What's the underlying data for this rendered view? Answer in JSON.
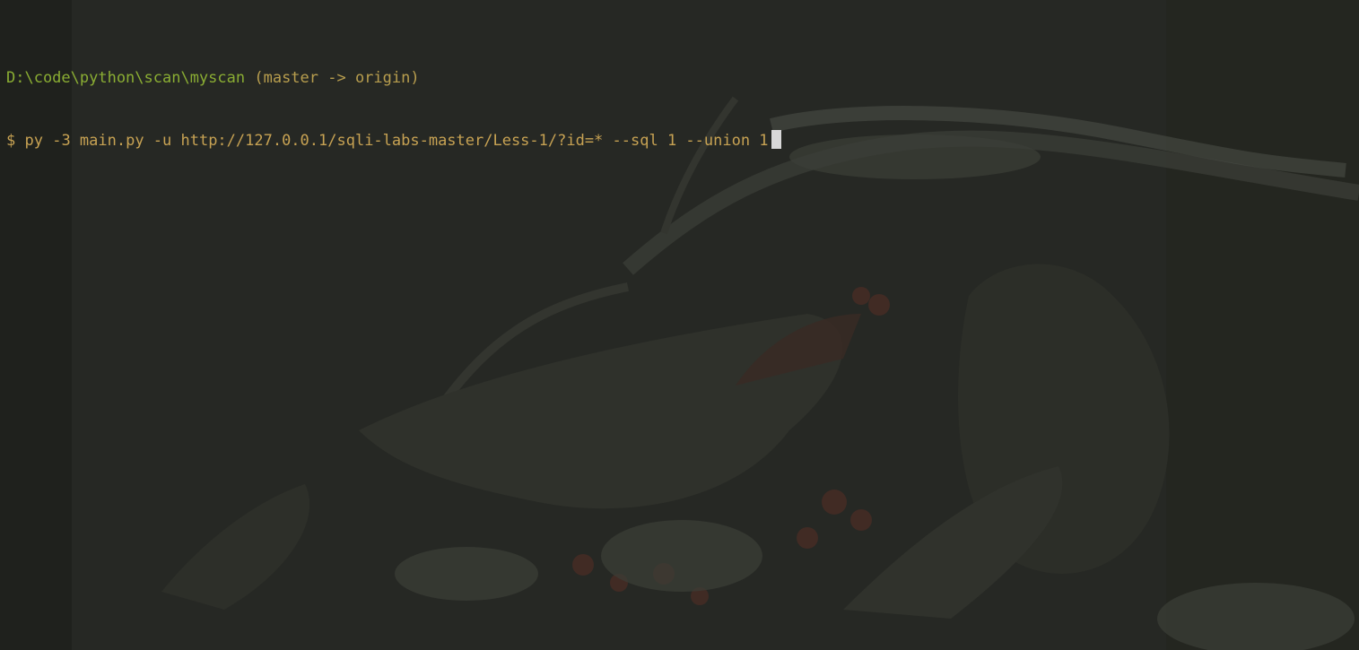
{
  "terminal": {
    "cwd_path": "D:\\code\\python\\scan\\myscan",
    "git_info": "(master -> origin)",
    "prompt_symbol": "$",
    "command": "py -3 main.py -u http://127.0.0.1/sqli-labs-master/Less-1/?id=* --sql 1 --union 1"
  },
  "colors": {
    "background": "#262824",
    "path": "#8aad33",
    "branch": "#b89e4e",
    "command": "#c7a253",
    "cursor": "#d8d8d8"
  }
}
